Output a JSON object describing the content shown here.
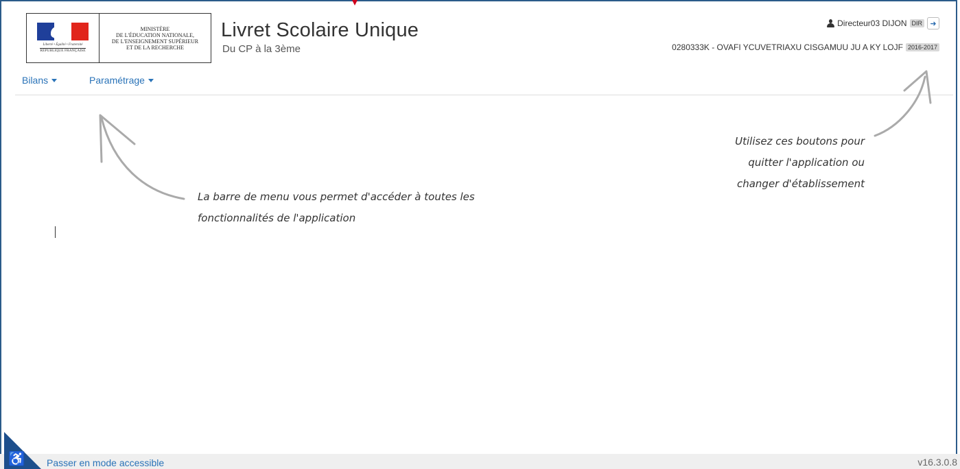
{
  "logo": {
    "motto": "Liberté • Égalité • Fraternité",
    "republic": "RÉPUBLIQUE FRANÇAISE",
    "ministry": "MINISTÈRE\nDE L'ÉDUCATION NATIONALE,\nDE L'ENSEIGNEMENT SUPÉRIEUR\nET DE LA RECHERCHE"
  },
  "header": {
    "title": "Livret Scolaire Unique",
    "subtitle": "Du CP à la 3ème",
    "user_name": "Directeur03 DIJON",
    "user_role": "DIR",
    "user_icon": "user-icon",
    "logout_icon": "logout-icon",
    "establishment": "0280333K - OVAFI YCUVETRIAXU CISGAMUU JU A KY LOJF",
    "school_year": "2016-2017"
  },
  "nav": {
    "items": [
      {
        "label": "Bilans"
      },
      {
        "label": "Paramétrage"
      }
    ]
  },
  "annotations": {
    "menu": "La barre de menu vous permet d'accéder à toutes les\nfonctionnalités de l'application",
    "buttons": "Utilisez ces boutons pour\nquitter l'application ou\nchanger d'établissement"
  },
  "footer": {
    "accessibility_icon": "accessibility-icon",
    "accessible_link": "Passer en mode accessible",
    "version": "v16.3.0.8"
  },
  "colors": {
    "accent": "#2a73b8",
    "frame": "#2b5b8a",
    "marker": "#d0021b"
  }
}
